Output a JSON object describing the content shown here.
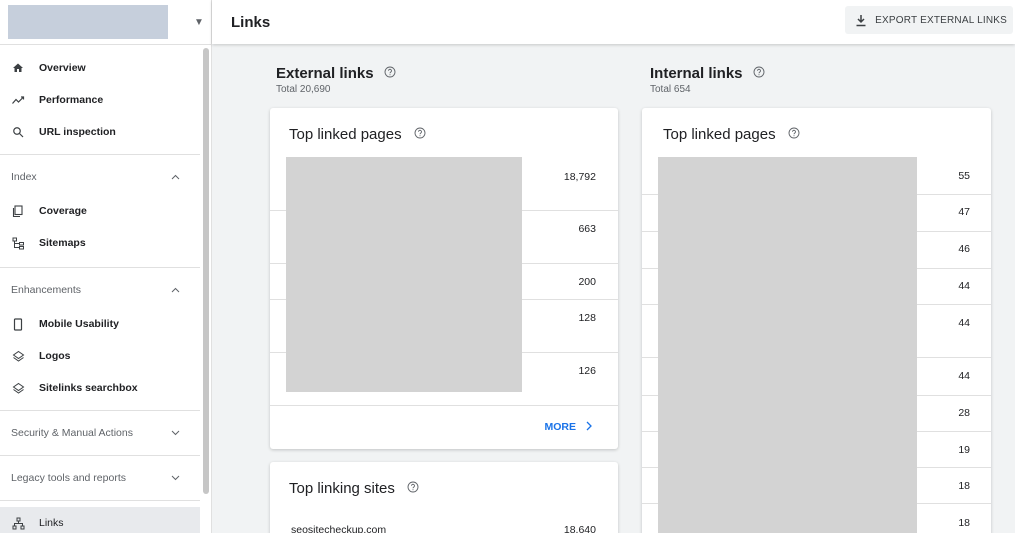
{
  "sidebar": {
    "items_main": [
      {
        "label": "Overview",
        "icon": "home-icon"
      },
      {
        "label": "Performance",
        "icon": "trend-icon"
      },
      {
        "label": "URL inspection",
        "icon": "search-icon"
      }
    ],
    "index": {
      "heading": "Index",
      "items": [
        {
          "label": "Coverage",
          "icon": "coverage-icon"
        },
        {
          "label": "Sitemaps",
          "icon": "sitemap-icon"
        }
      ]
    },
    "enhancements": {
      "heading": "Enhancements",
      "items": [
        {
          "label": "Mobile Usability",
          "icon": "phone-icon"
        },
        {
          "label": "Logos",
          "icon": "layers-icon"
        },
        {
          "label": "Sitelinks searchbox",
          "icon": "layers-icon"
        }
      ]
    },
    "security_heading": "Security & Manual Actions",
    "legacy_heading": "Legacy tools and reports",
    "links_label": "Links"
  },
  "header": {
    "title": "Links",
    "export_label": "EXPORT EXTERNAL LINKS"
  },
  "external": {
    "title": "External links",
    "total": "Total 20,690",
    "top_linked_pages": {
      "title": "Top linked pages",
      "values": [
        "18,792",
        "663",
        "200",
        "128",
        "126"
      ],
      "more_label": "MORE"
    },
    "top_linking_sites": {
      "title": "Top linking sites",
      "first_site": "seositecheckup.com",
      "first_value": "18,640"
    }
  },
  "internal": {
    "title": "Internal links",
    "total": "Total 654",
    "top_linked_pages": {
      "title": "Top linked pages",
      "values": [
        "55",
        "47",
        "46",
        "44",
        "44",
        "44",
        "28",
        "19",
        "18",
        "18"
      ]
    }
  },
  "colors": {
    "accent": "#1a73e8",
    "redaction": "#d3d3d3",
    "property_selector": "#c6cfdc"
  }
}
